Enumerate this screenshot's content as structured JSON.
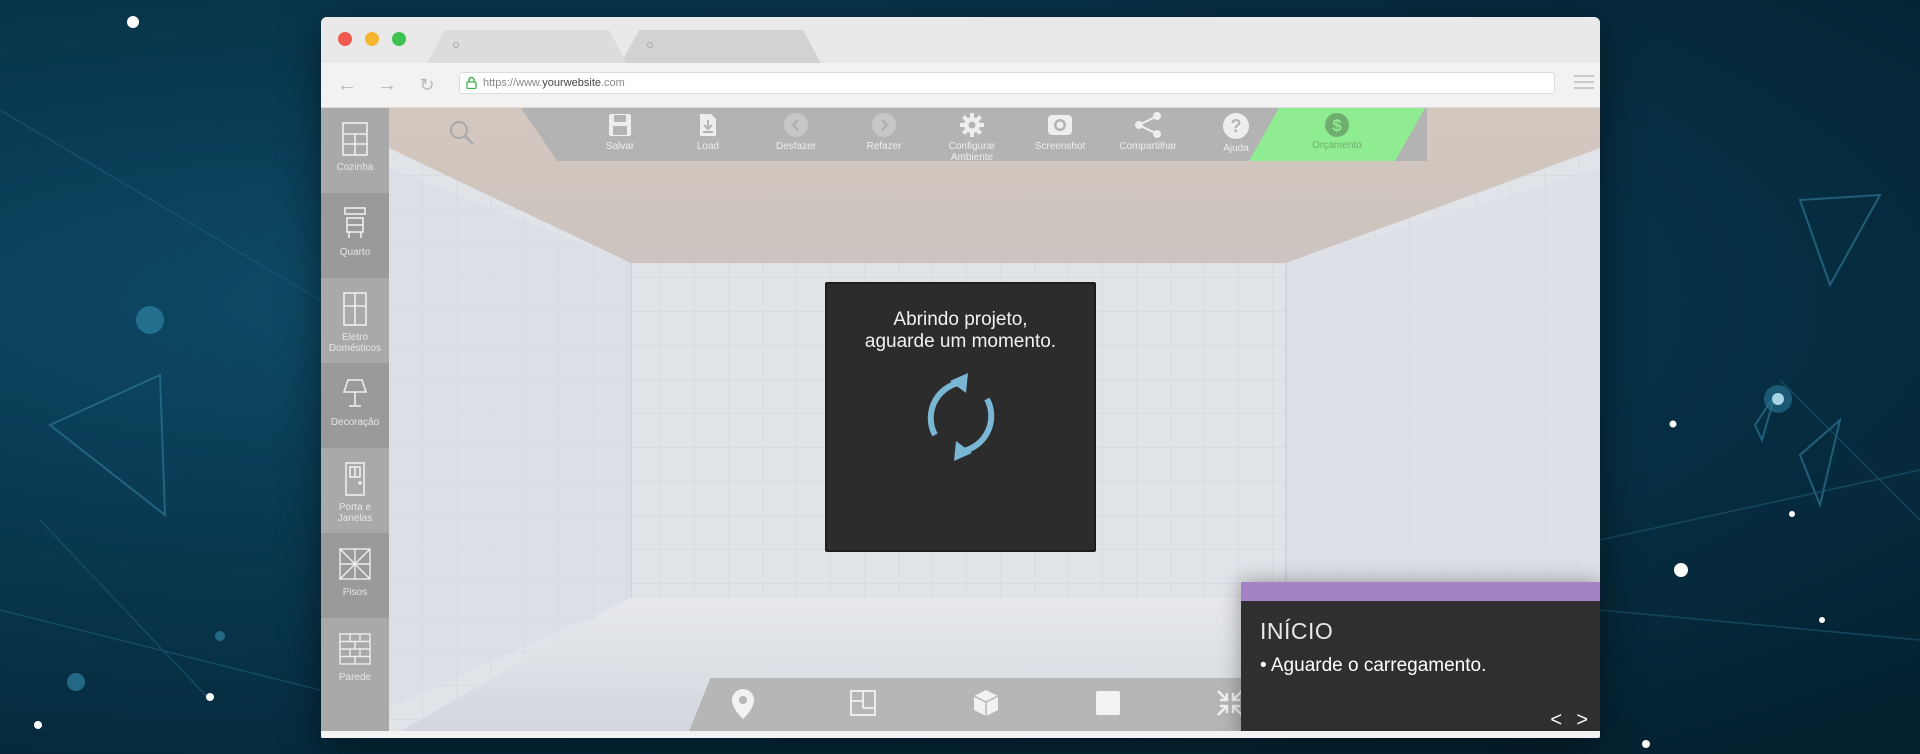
{
  "browser": {
    "url_prefix": "https://www.",
    "url_domain": "yourwebsite",
    "url_suffix": ".com"
  },
  "sidebar": {
    "items": [
      {
        "label": "Cozinha",
        "icon": "cabinet-icon"
      },
      {
        "label": "Quarto",
        "icon": "dresser-icon"
      },
      {
        "label": "Eletro Domésticos",
        "icon": "fridge-icon"
      },
      {
        "label": "Decoração",
        "icon": "lamp-icon"
      },
      {
        "label": "Porta e Janelas",
        "icon": "door-icon"
      },
      {
        "label": "Pisos",
        "icon": "floor-tile-icon"
      },
      {
        "label": "Parede",
        "icon": "brick-wall-icon"
      }
    ]
  },
  "toolbar": {
    "items": [
      {
        "label": "Salvar",
        "icon": "floppy-icon"
      },
      {
        "label": "Load",
        "icon": "file-download-icon"
      },
      {
        "label": "Desfazer",
        "icon": "undo-icon"
      },
      {
        "label": "Refazer",
        "icon": "redo-icon"
      },
      {
        "label": "Configurar Ambiente",
        "icon": "gear-icon"
      },
      {
        "label": "Screenshot",
        "icon": "camera-icon"
      },
      {
        "label": "Compartilhar",
        "icon": "share-icon"
      },
      {
        "label": "Ajuda",
        "icon": "help-icon"
      }
    ],
    "budget_label": "Orçamento"
  },
  "loading": {
    "line1": "Abrindo projeto,",
    "line2": "aguarde um momento."
  },
  "bottom_bar": {
    "icons": [
      "location-pin-icon",
      "floor-plan-icon",
      "3d-cube-icon",
      "square-icon",
      "collapse-icon"
    ]
  },
  "tutorial": {
    "title": "INÍCIO",
    "body": "• Aguarde o carregamento.",
    "prev": "<",
    "next": ">"
  },
  "colors": {
    "background": "#062b3e",
    "budget_green": "#90ec90",
    "tutorial_accent": "#a383c4",
    "refresh_blue": "#7ab7d4"
  }
}
